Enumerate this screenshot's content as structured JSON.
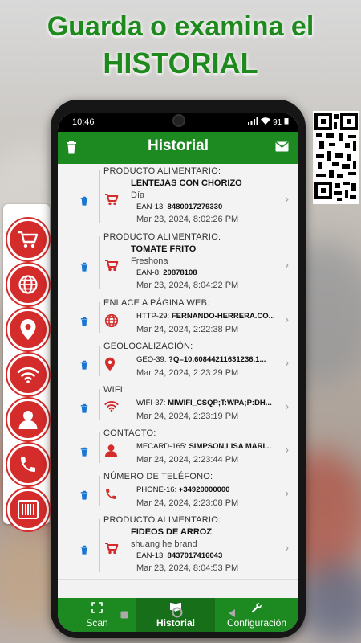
{
  "headline": {
    "line1": "Guarda o examina el",
    "line2": "HISTORIAL"
  },
  "status": {
    "time": "10:46",
    "battery": "91"
  },
  "appbar": {
    "title": "Historial"
  },
  "items": [
    {
      "category": "PRODUCTO ALIMENTARIO:",
      "title": "LENTEJAS CON CHORIZO",
      "sub": "Día",
      "code_prefix": "EAN-13:",
      "code": "8480017279330",
      "date": "Mar 23, 2024, 8:02:26 PM",
      "kind_icon": "cart-icon"
    },
    {
      "category": "PRODUCTO ALIMENTARIO:",
      "title": "TOMATE FRITO",
      "sub": "Freshona",
      "code_prefix": "EAN-8:",
      "code": "20878108",
      "date": "Mar 23, 2024, 8:04:22 PM",
      "kind_icon": "cart-icon"
    },
    {
      "category": "ENLACE A PÁGINA WEB:",
      "code_prefix": "HTTP-29:",
      "code": "FERNANDO-HERRERA.CO...",
      "date": "Mar 24, 2024, 2:22:38 PM",
      "kind_icon": "globe-icon"
    },
    {
      "category": "GEOLOCALIZACIÓN:",
      "code_prefix": "GEO-39:",
      "code": "?Q=10.60844211631236,1...",
      "date": "Mar 24, 2024, 2:23:29 PM",
      "kind_icon": "location-pin-icon"
    },
    {
      "category": "WIFI:",
      "code_prefix": "WIFI-37:",
      "code": "MIWIFI_CSQP;T:WPA;P:DH...",
      "date": "Mar 24, 2024, 2:23:19 PM",
      "kind_icon": "wifi-icon"
    },
    {
      "category": "CONTACTO:",
      "code_prefix": "MECARD-165:",
      "code": "SIMPSON,LISA MARI...",
      "date": "Mar 24, 2024, 2:23:44 PM",
      "kind_icon": "person-icon"
    },
    {
      "category": "NÚMERO DE TELÉFONO:",
      "code_prefix": "PHONE-16:",
      "code": "+34920000000",
      "date": "Mar 24, 2024, 2:23:08 PM",
      "kind_icon": "phone-icon"
    },
    {
      "category": "PRODUCTO ALIMENTARIO:",
      "title": "FIDEOS DE ARROZ",
      "sub": "shuang he brand",
      "code_prefix": "EAN-13:",
      "code": "8437017416043",
      "date": "Mar 23, 2024, 8:04:53 PM",
      "kind_icon": "cart-icon"
    }
  ],
  "nav": {
    "scan": "Scan",
    "historial": "Historial",
    "config": "Configuración"
  },
  "rail_icons": [
    "cart-icon",
    "globe-icon",
    "location-pin-icon",
    "wifi-icon",
    "person-icon",
    "phone-icon",
    "barcode-icon"
  ],
  "colors": {
    "brand_green": "#1c8a20",
    "accent_red": "#d42b2b",
    "delete_blue": "#1976d2"
  }
}
